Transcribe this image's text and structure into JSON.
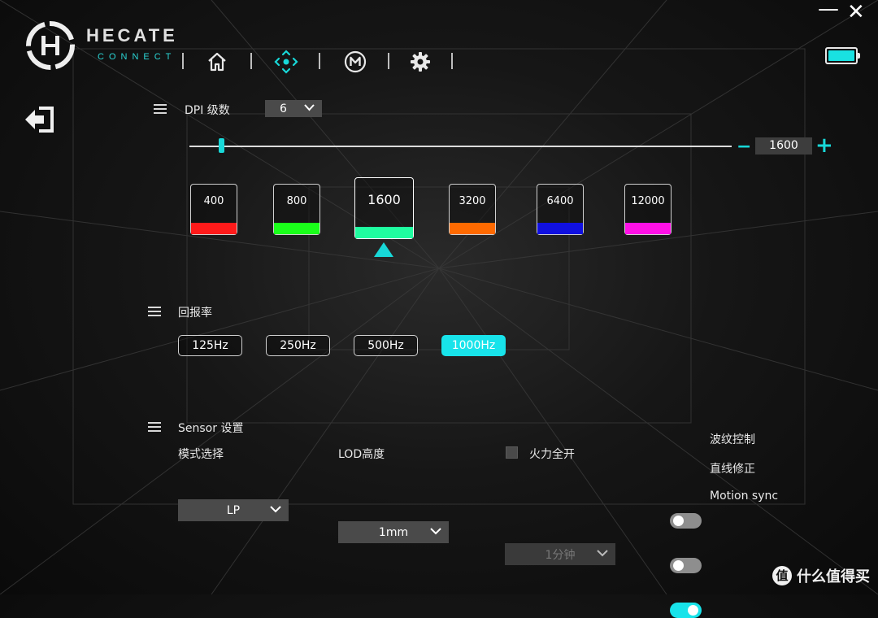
{
  "brand": {
    "name": "HECATE",
    "subtitle": "CONNECT"
  },
  "nav": {
    "icons": [
      "home-icon",
      "crosshair-icon",
      "macro-icon",
      "gear-icon"
    ],
    "active": "crosshair-icon"
  },
  "window": {
    "minimize": "—",
    "close": "✕"
  },
  "battery": {
    "level": 1.0,
    "color": "#19e1e1"
  },
  "accent": "#18e3ea",
  "dpi": {
    "section_title": "DPI 级数",
    "levels_value": "6",
    "current_value": "1600",
    "slider_min": 100,
    "slider_max": 26000,
    "slider_value": 1600,
    "minus": "−",
    "plus": "+",
    "stages": [
      {
        "label": "400",
        "color": "#ff1a1a"
      },
      {
        "label": "800",
        "color": "#1aff1a"
      },
      {
        "label": "1600",
        "color": "#1ffda0"
      },
      {
        "label": "3200",
        "color": "#ff6a00"
      },
      {
        "label": "6400",
        "color": "#1010e0"
      },
      {
        "label": "12000",
        "color": "#ff10e6"
      }
    ],
    "selected_stage": 2
  },
  "polling": {
    "section_title": "回报率",
    "options": [
      "125Hz",
      "250Hz",
      "500Hz",
      "1000Hz"
    ],
    "selected": "1000Hz"
  },
  "sensor": {
    "section_title": "Sensor 设置",
    "mode_label": "模式选择",
    "mode_value": "LP",
    "lod_label": "LOD高度",
    "lod_value": "1mm",
    "fire_label": "火力全开",
    "fire_checked": false,
    "fire_value": "1分钟",
    "toggles": [
      {
        "label": "波纹控制",
        "on": false
      },
      {
        "label": "直线修正",
        "on": false
      },
      {
        "label": "Motion sync",
        "on": true
      }
    ]
  },
  "watermark": {
    "icon_text": "值",
    "text": "什么值得买"
  }
}
